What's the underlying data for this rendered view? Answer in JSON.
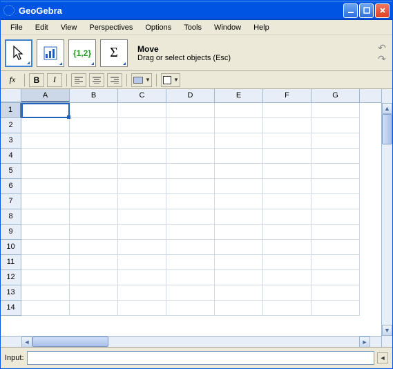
{
  "window": {
    "title": "GeoGebra"
  },
  "menu": {
    "items": [
      "File",
      "Edit",
      "View",
      "Perspectives",
      "Options",
      "Tools",
      "Window",
      "Help"
    ]
  },
  "toolbar": {
    "tool_title": "Move",
    "tool_subtitle": "Drag or select objects (Esc)",
    "list_icon_text": "{1,2}",
    "sigma_text": "Σ"
  },
  "format": {
    "fx": "fx",
    "bold": "B",
    "italic": "I"
  },
  "spreadsheet": {
    "columns": [
      "A",
      "B",
      "C",
      "D",
      "E",
      "F",
      "G"
    ],
    "rows": [
      "1",
      "2",
      "3",
      "4",
      "5",
      "6",
      "7",
      "8",
      "9",
      "10",
      "11",
      "12",
      "13",
      "14"
    ],
    "active": "A1"
  },
  "input": {
    "label": "Input:",
    "value": ""
  }
}
